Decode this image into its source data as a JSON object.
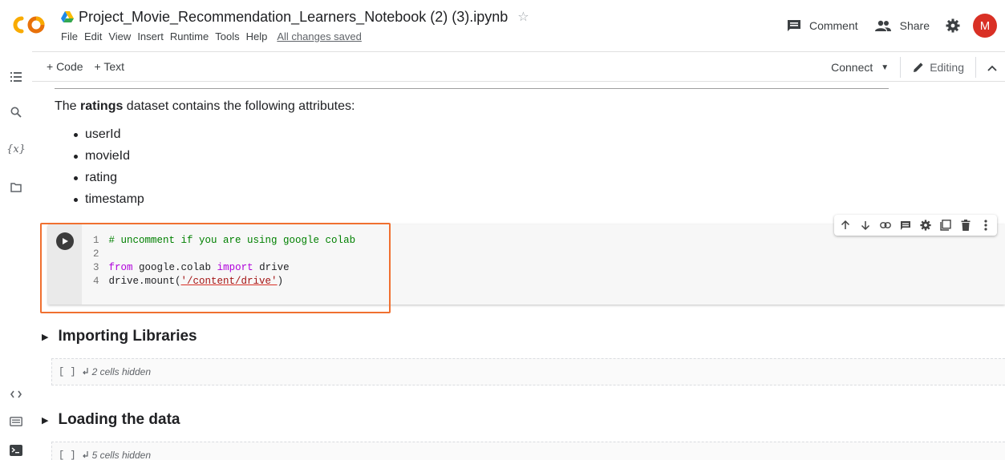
{
  "header": {
    "logo_text": "CO",
    "title": "Project_Movie_Recommendation_Learners_Notebook (2) (3).ipynb",
    "star_icon": "star-icon",
    "menu": [
      "File",
      "Edit",
      "View",
      "Insert",
      "Runtime",
      "Tools",
      "Help"
    ],
    "save_status": "All changes saved",
    "comment_label": "Comment",
    "share_label": "Share",
    "avatar_letter": "M",
    "avatar_color": "#d93025"
  },
  "toolbar": {
    "add_code": "+ Code",
    "add_text": "+ Text",
    "connect_label": "Connect",
    "editing_label": "Editing"
  },
  "rail": {
    "variables_label": "{x}"
  },
  "text_cell": {
    "intro_prefix": "The ",
    "intro_bold": "ratings",
    "intro_suffix": " dataset contains the following attributes:",
    "attributes": [
      "userId",
      "movieId",
      "rating",
      "timestamp"
    ]
  },
  "code_cell": {
    "line1_num": "1",
    "line1_comment": "# uncomment if you are using google colab",
    "line2_num": "2",
    "line3_num": "3",
    "line3_from": "from",
    "line3_module": " google.colab ",
    "line3_import": "import",
    "line3_name": " drive",
    "line4_num": "4",
    "line4_call": "drive.mount(",
    "line4_string": "'/content/drive'",
    "line4_close": ")"
  },
  "sections": [
    {
      "title": "Importing Libraries",
      "hidden_label": "[ ]",
      "hidden_text": "2 cells hidden"
    },
    {
      "title": "Loading the data",
      "hidden_label": "[ ]",
      "hidden_text": "5 cells hidden"
    }
  ],
  "colors": {
    "highlight_box": "#f07030",
    "colab_orange": "#f9ab00"
  }
}
